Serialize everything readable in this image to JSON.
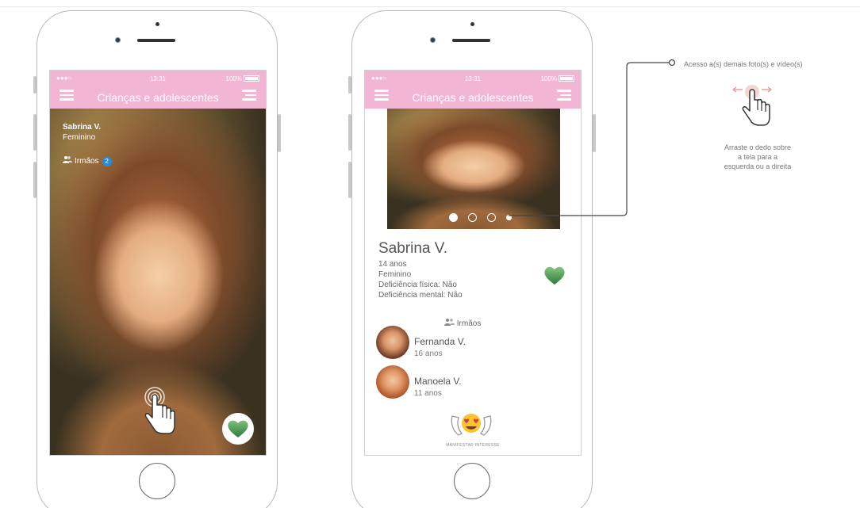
{
  "phone_a": {
    "status": {
      "dots": "●●●○",
      "time": "13:31",
      "battery": "100%"
    },
    "title": "Crianças e adolescentes",
    "overlay": {
      "name": "Sabrina V.",
      "gender": "Feminino",
      "siblings_label": "Irmãos",
      "siblings_count": "2"
    },
    "icons": [
      "menu-icon",
      "filter-icon",
      "people-icon",
      "tap-gesture-icon",
      "heart-icon"
    ]
  },
  "phone_b": {
    "status": {
      "dots": "●●●○",
      "time": "13:31",
      "battery": "100%"
    },
    "title": "Crianças e adolescentes",
    "profile": {
      "name": "Sabrina V.",
      "age": "14 anos",
      "gender": "Feminino",
      "physical": "Deficiência física: Não",
      "mental": "Deficiência mental: Não"
    },
    "siblings_title": "Irmãos",
    "siblings": [
      {
        "name": "Fernanda V.",
        "age": "16 anos"
      },
      {
        "name": "Manoela V.",
        "age": "11 anos"
      }
    ],
    "interest_label": "MANIFESTAR INTERESSE",
    "photo_pager": {
      "count": 4,
      "active": 0
    }
  },
  "annotation": {
    "text": "Acesso a(s) demais foto(s) e vídeo(s)",
    "caption_line1": "Arraste o dedo sobre",
    "caption_line2": "a tela para a",
    "caption_line3": "esquerda ou a direita"
  },
  "colors": {
    "accent_pink": "#f3b5d4",
    "heart_green": "#4f9b56",
    "badge_blue": "#2b8bd3",
    "swipe_arrow_red": "#e8a0a0"
  }
}
